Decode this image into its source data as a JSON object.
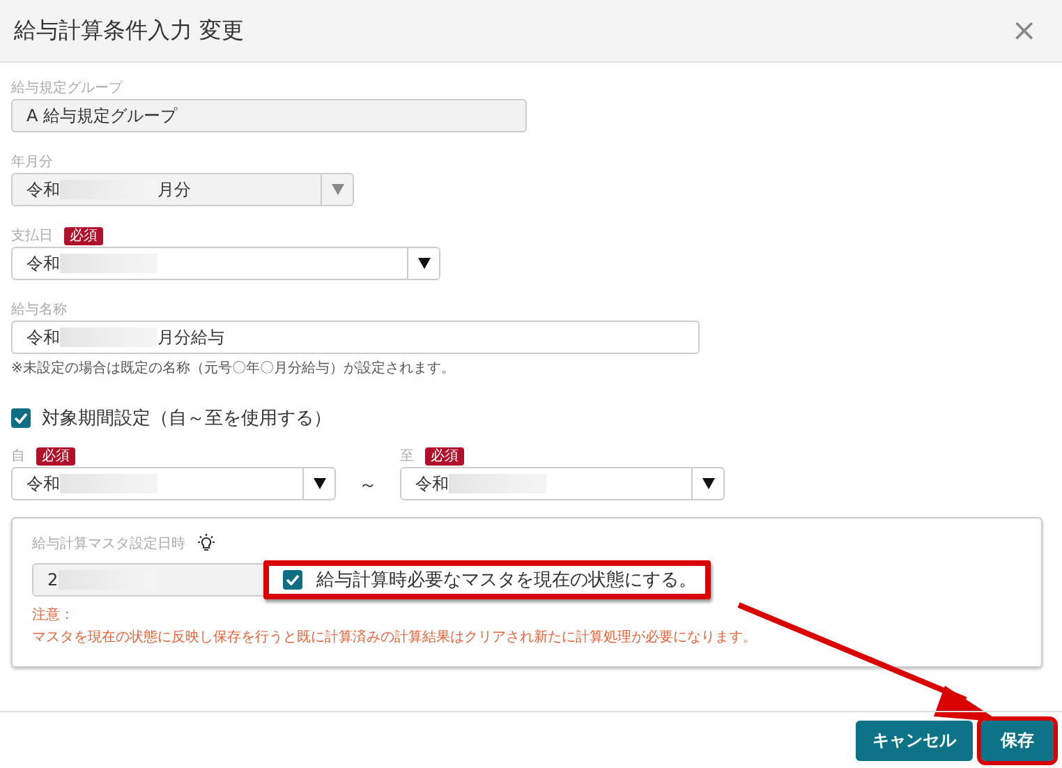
{
  "dialog": {
    "title": "給与計算条件入力 変更",
    "close": "×"
  },
  "fields": [
    {
      "label": "給与規定グループ",
      "kind": "text",
      "disabled": true,
      "value": "A 給与規定グループ",
      "redacted": false
    },
    {
      "label": "年月分",
      "kind": "select",
      "disabled": true,
      "value": "令和",
      "redacted": true,
      "suffix": "月分"
    },
    {
      "label": "支払日",
      "kind": "select",
      "disabled": false,
      "badge": "必須",
      "value": "令和",
      "redacted": true
    },
    {
      "label": "給与名称",
      "kind": "text",
      "disabled": false,
      "value": "令和",
      "redacted": true,
      "suffix": "月分給与"
    }
  ],
  "name_note": "※未設定の場合は既定の名称（元号〇年〇月分給与）が設定されます。",
  "period": {
    "checked": true,
    "label": "対象期間設定（自～至を使用する）",
    "separator": "～",
    "from": {
      "label": "自",
      "badge": "必須",
      "value": "令和",
      "redacted": true
    },
    "to": {
      "label": "至",
      "badge": "必須",
      "value": "令和",
      "redacted": true
    }
  },
  "master": {
    "label": "給与計算マスタ設定日時",
    "value": "2",
    "redacted": true,
    "apply": {
      "checked": true,
      "label": "給与計算時必要なマスタを現在の状態にする。"
    },
    "caution_title": "注意：",
    "caution": "マスタを現在の状態に反映し保存を行うと既に計算済みの計算結果はクリアされ新たに計算処理が必要になります。"
  },
  "buttons": [
    {
      "label": "キャンセル",
      "highlighted": false
    },
    {
      "label": "保存",
      "highlighted": true
    }
  ]
}
